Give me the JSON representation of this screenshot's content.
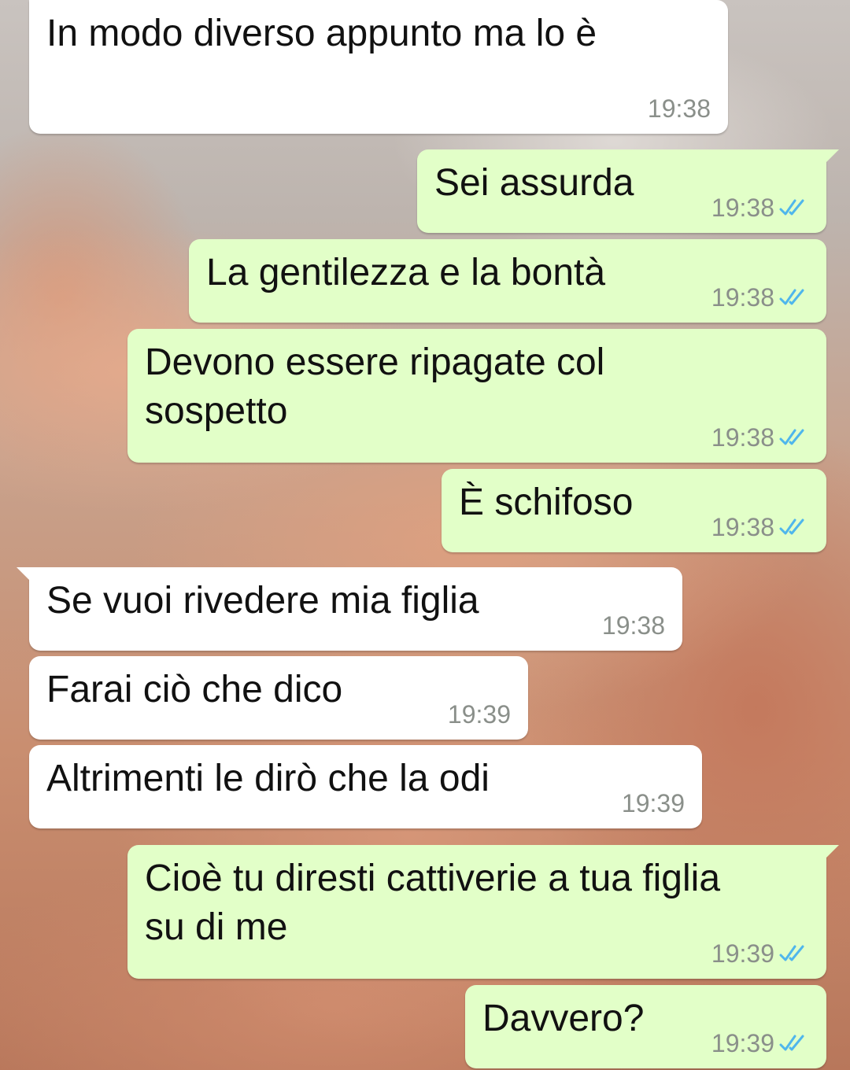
{
  "messages": [
    {
      "text": "In modo diverso appunto ma lo è",
      "time": "19:38",
      "direction": "in"
    },
    {
      "text": "Sei assurda",
      "time": "19:38",
      "direction": "out",
      "status": "read"
    },
    {
      "text": "La gentilezza e la bontà",
      "time": "19:38",
      "direction": "out",
      "status": "read"
    },
    {
      "text": "Devono essere ripagate col\nsospetto",
      "time": "19:38",
      "direction": "out",
      "status": "read"
    },
    {
      "text": "È schifoso",
      "time": "19:38",
      "direction": "out",
      "status": "read"
    },
    {
      "text": "Se vuoi rivedere mia figlia",
      "time": "19:38",
      "direction": "in"
    },
    {
      "text": "Farai ciò che dico",
      "time": "19:39",
      "direction": "in"
    },
    {
      "text": "Altrimenti le dirò che la odi",
      "time": "19:39",
      "direction": "in"
    },
    {
      "text": "Cioè tu diresti cattiverie a tua figlia\nsu di me",
      "time": "19:39",
      "direction": "out",
      "status": "read"
    },
    {
      "text": "Davvero?",
      "time": "19:39",
      "direction": "out",
      "status": "read"
    }
  ],
  "colors": {
    "incoming_bubble": "#ffffff",
    "outgoing_bubble": "#e2ffc8",
    "read_ticks": "#4fb6ec",
    "timestamp": "#8a8f8a"
  },
  "icons": {
    "read_receipt": "double-check-icon"
  }
}
